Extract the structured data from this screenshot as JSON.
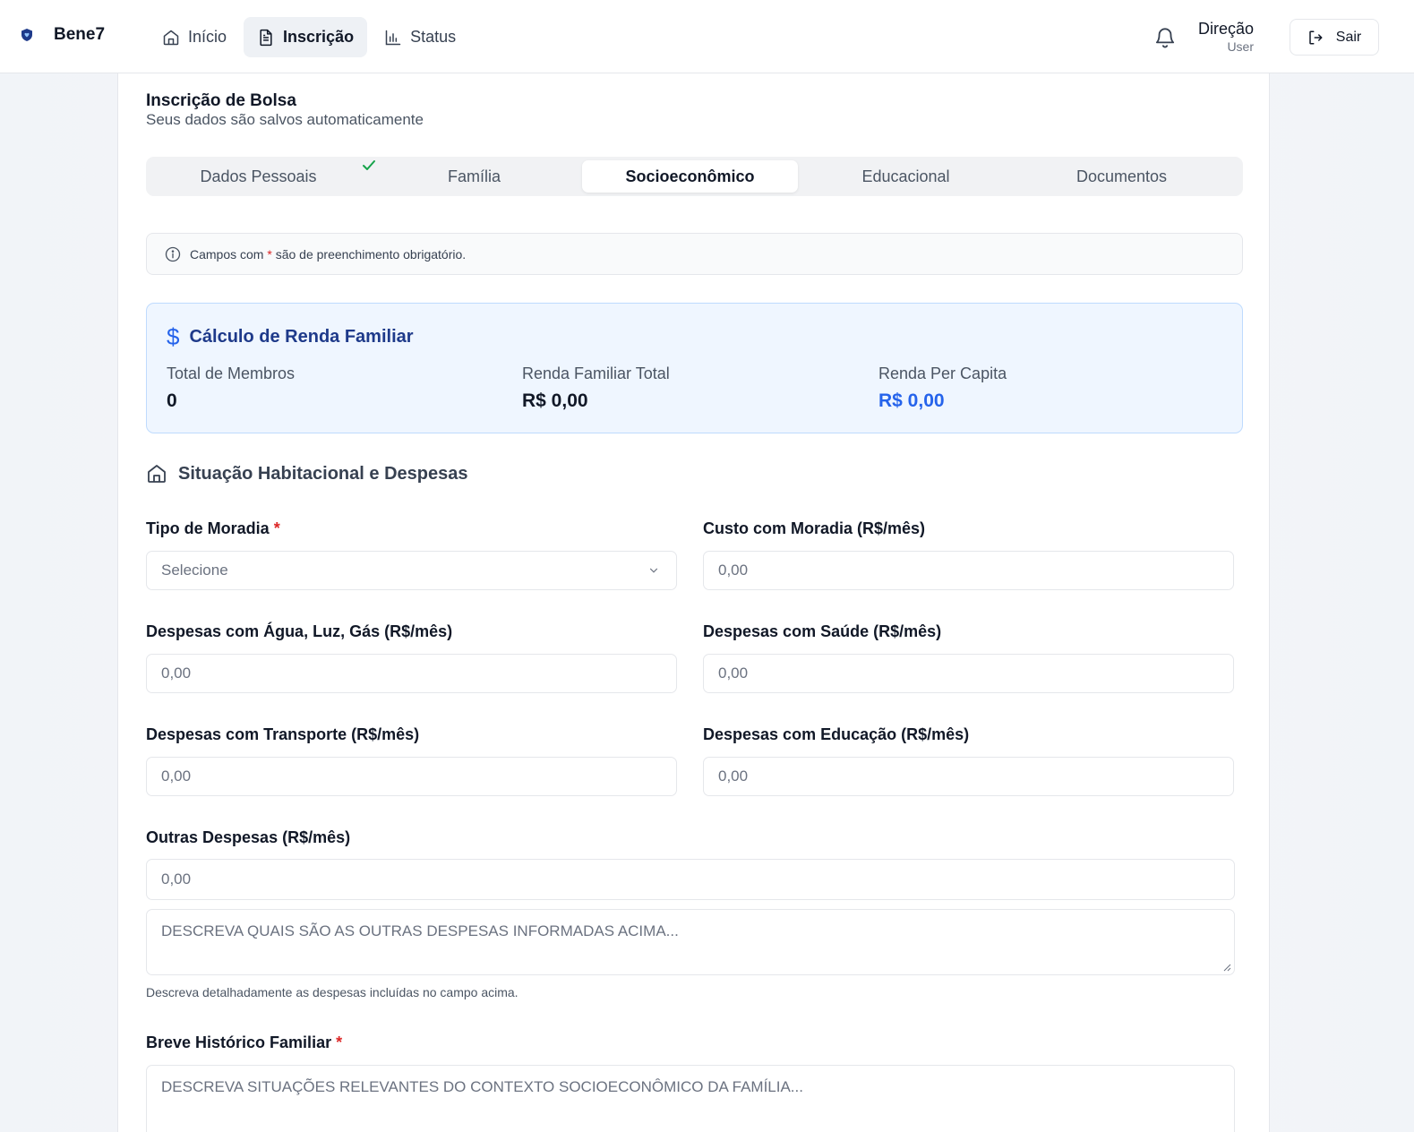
{
  "app": {
    "name": "Bene7"
  },
  "nav": {
    "items": [
      {
        "label": "Início",
        "icon": "home-icon"
      },
      {
        "label": "Inscrição",
        "icon": "document-icon"
      },
      {
        "label": "Status",
        "icon": "bar-chart-icon"
      }
    ],
    "active": "Inscrição"
  },
  "user": {
    "name": "Direção",
    "role": "User"
  },
  "logout": {
    "label": "Sair"
  },
  "page": {
    "title": "Inscrição de Bolsa",
    "subtitle": "Seus dados são salvos automaticamente"
  },
  "tabs": [
    {
      "label": "Dados Pessoais",
      "completed": true
    },
    {
      "label": "Família",
      "completed": false
    },
    {
      "label": "Socioeconômico",
      "completed": false
    },
    {
      "label": "Educacional",
      "completed": false
    },
    {
      "label": "Documentos",
      "completed": false
    }
  ],
  "active_tab": "Socioeconômico",
  "notice": {
    "prefix": "Campos com",
    "asterisk": "*",
    "suffix": "são de preenchimento obrigatório."
  },
  "income": {
    "title": "Cálculo de Renda Familiar",
    "members_label": "Total de Membros",
    "members_value": "0",
    "total_label": "Renda Familiar Total",
    "total_value": "R$ 0,00",
    "per_capita_label": "Renda Per Capita",
    "per_capita_value": "R$ 0,00",
    "accent": "#2563eb"
  },
  "housing": {
    "section_title": "Situação Habitacional e Despesas",
    "tipo_moradia": {
      "label": "Tipo de Moradia",
      "required": "*",
      "value": "Selecione"
    },
    "custo_moradia": {
      "label": "Custo com Moradia (R$/mês)",
      "value": "0,00"
    },
    "agua_luz_gas": {
      "label": "Despesas com Água, Luz, Gás (R$/mês)",
      "value": "0,00"
    },
    "saude": {
      "label": "Despesas com Saúde (R$/mês)",
      "value": "0,00"
    },
    "transporte": {
      "label": "Despesas com Transporte (R$/mês)",
      "value": "0,00"
    },
    "educacao": {
      "label": "Despesas com Educação (R$/mês)",
      "value": "0,00"
    },
    "outras": {
      "label": "Outras Despesas (R$/mês)",
      "value": "0,00",
      "description_placeholder": "DESCREVA QUAIS SÃO AS OUTRAS DESPESAS INFORMADAS ACIMA...",
      "hint": "Descreva detalhadamente as despesas incluídas no campo acima."
    },
    "historico": {
      "label": "Breve Histórico Familiar",
      "required": "*",
      "placeholder": "DESCREVA SITUAÇÕES RELEVANTES DO CONTEXTO SOCIOECONÔMICO DA FAMÍLIA..."
    }
  },
  "colors": {
    "required": "#dc2626",
    "success": "#16a34a",
    "income_bg": "#eff6ff"
  }
}
